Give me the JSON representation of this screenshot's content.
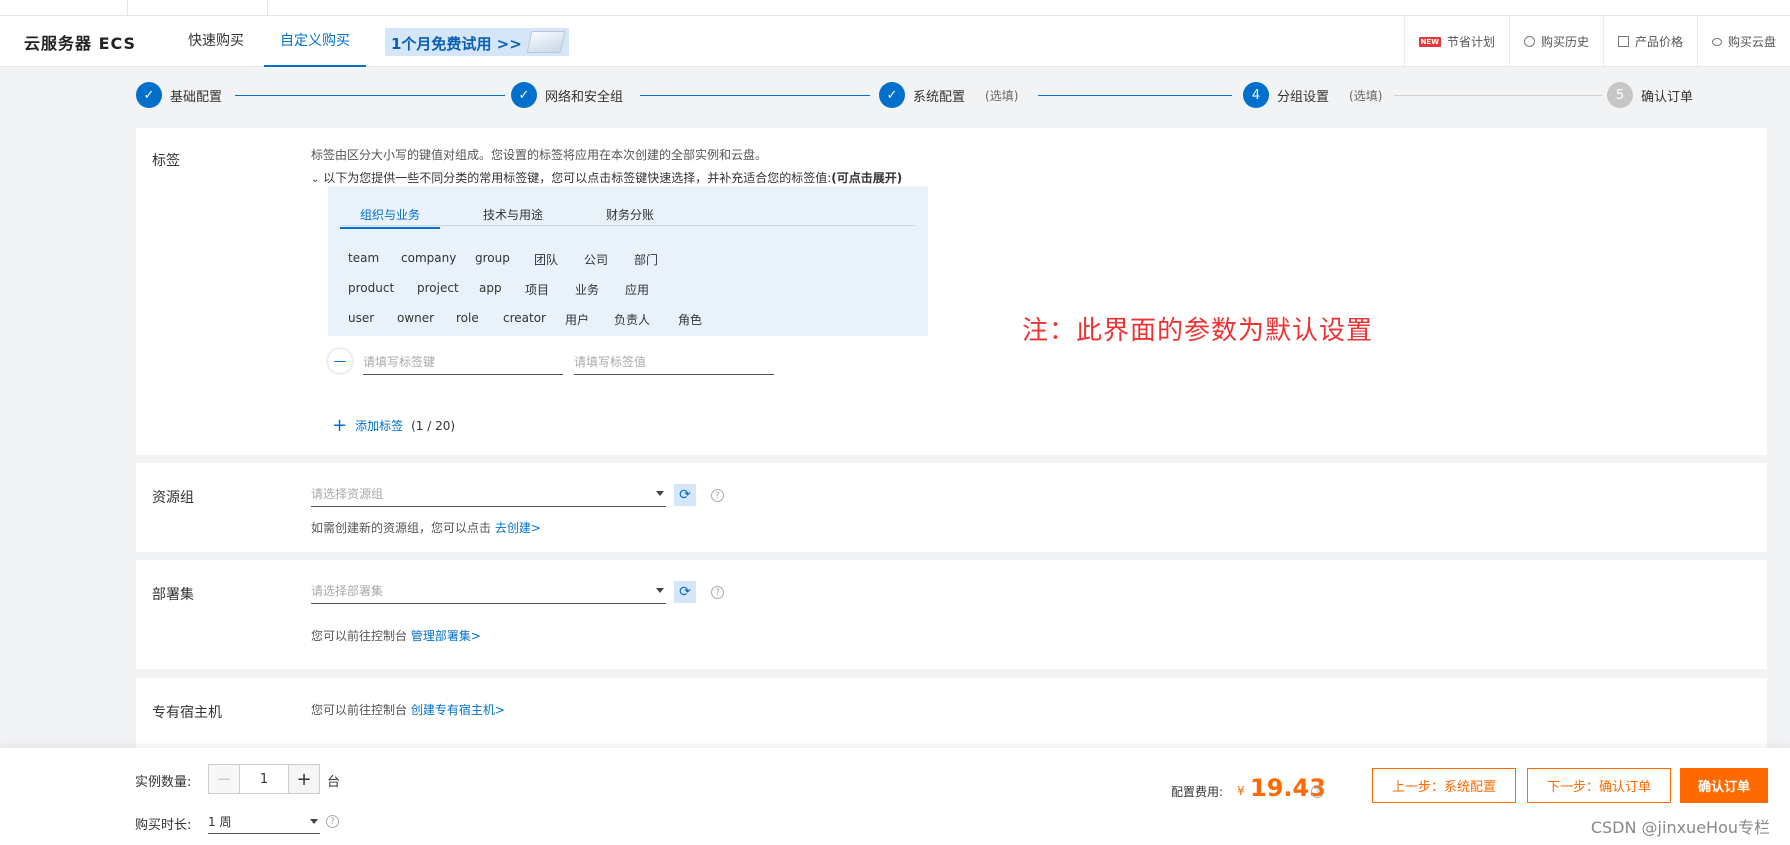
{
  "header": {
    "logo": "云服务器 ECS",
    "tabs": [
      {
        "label": "快速购买"
      },
      {
        "label": "自定义购买"
      }
    ],
    "trial": "1个月免费试用 >>",
    "links": [
      {
        "label": "节省计划",
        "badge": "NEW",
        "icon": "new-badge-icon"
      },
      {
        "label": "购买历史",
        "icon": "clock-icon"
      },
      {
        "label": "产品价格",
        "icon": "price-list-icon"
      },
      {
        "label": "购买云盘",
        "icon": "cloud-disk-icon"
      }
    ]
  },
  "steps": [
    {
      "label": "基础配置",
      "state": "done"
    },
    {
      "label": "网络和安全组",
      "state": "done"
    },
    {
      "label": "系统配置",
      "optional": "(选填)",
      "state": "done"
    },
    {
      "num": "4",
      "label": "分组设置",
      "optional": "(选填)",
      "state": "active"
    },
    {
      "num": "5",
      "label": "确认订单",
      "state": "pending"
    }
  ],
  "tags": {
    "label": "标签",
    "desc": "标签由区分大小写的键值对组成。您设置的标签将应用在本次创建的全部实例和云盘。",
    "suggest": "以下为您提供一些不同分类的常用标签键，您可以点击标签键快速选择，并补充适合您的标签值:",
    "suggest_bold": "(可点击展开)",
    "tabs": [
      {
        "label": "组织与业务"
      },
      {
        "label": "技术与用途"
      },
      {
        "label": "财务分账"
      }
    ],
    "rows": [
      [
        "team",
        "company",
        "group",
        "团队",
        "公司",
        "部门"
      ],
      [
        "product",
        "project",
        "app",
        "项目",
        "业务",
        "应用"
      ],
      [
        "user",
        "owner",
        "role",
        "creator",
        "用户",
        "负责人",
        "角色"
      ]
    ],
    "key_placeholder": "请填写标签键",
    "value_placeholder": "请填写标签值",
    "add_label": "添加标签",
    "add_count": "(1 / 20)"
  },
  "resource_group": {
    "label": "资源组",
    "placeholder": "请选择资源组",
    "hint": "如需创建新的资源组，您可以点击",
    "link": "去创建>"
  },
  "deployment_set": {
    "label": "部署集",
    "placeholder": "请选择部署集",
    "hint": "您可以前往控制台",
    "link": "管理部署集>"
  },
  "dedicated_host": {
    "label": "专有宿主机",
    "hint": "您可以前往控制台",
    "link": "创建专有宿主机>"
  },
  "note": "注：此界面的参数为默认设置",
  "footer": {
    "count_label": "实例数量:",
    "count": "1",
    "unit": "台",
    "duration_label": "购买时长:",
    "duration": "1 周",
    "fee_label": "配置费用:",
    "currency": "¥",
    "price": "19.43",
    "prev": "上一步：系统配置",
    "next": "下一步：确认订单",
    "confirm": "确认订单",
    "watermark": "CSDN @jinxueHou专栏"
  }
}
